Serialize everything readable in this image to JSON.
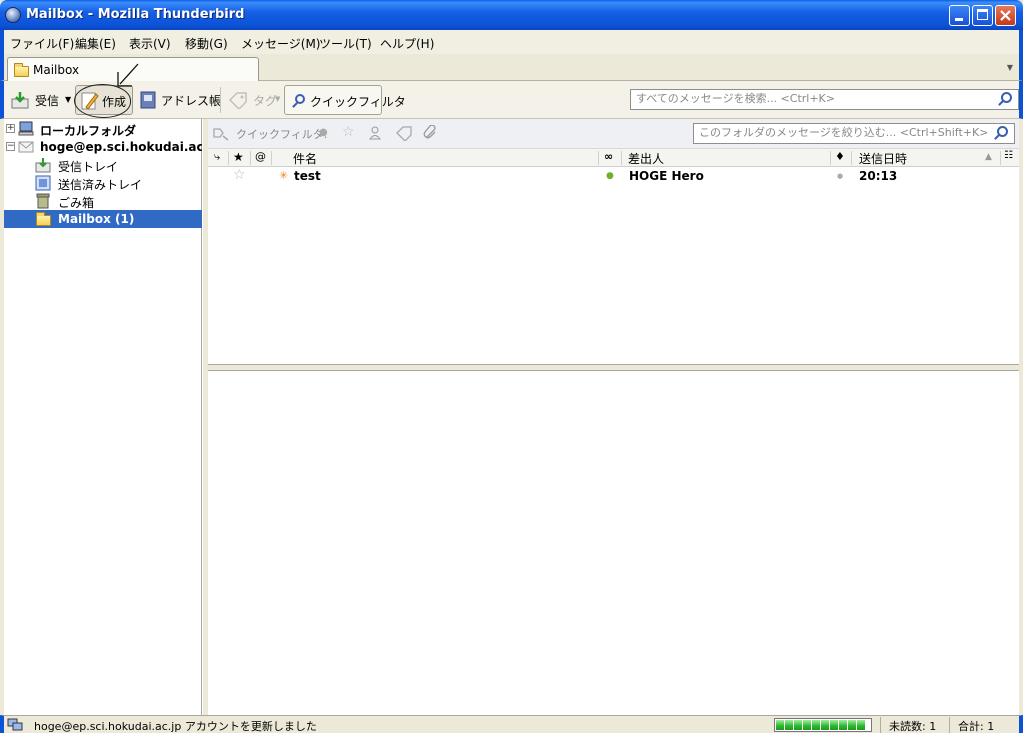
{
  "window": {
    "title": "Mailbox - Mozilla Thunderbird"
  },
  "menu": {
    "items": [
      "ファイル(F)",
      "編集(E)",
      "表示(V)",
      "移動(G)",
      "メッセージ(M)",
      "ツール(T)",
      "ヘルプ(H)"
    ]
  },
  "tab": {
    "label": "Mailbox"
  },
  "toolbar": {
    "get_mail": "受信",
    "compose": "作成",
    "address_book": "アドレス帳",
    "tag": "タグ",
    "quick_filter": "クイックフィルタ",
    "search_placeholder": "すべてのメッセージを検索... <Ctrl+K>"
  },
  "folders": {
    "local_folders": "ローカルフォルダ",
    "account": "hoge@ep.sci.hokudai.ac.jp",
    "inbox": "受信トレイ",
    "sent": "送信済みトレイ",
    "trash": "ごみ箱",
    "mailbox": "Mailbox (1)"
  },
  "quickfilter": {
    "label": "クイックフィルタ:",
    "placeholder": "このフォルダのメッセージを絞り込む... <Ctrl+Shift+K>"
  },
  "columns": {
    "subject": "件名",
    "from": "差出人",
    "date": "送信日時"
  },
  "messages": [
    {
      "subject": "test",
      "from": "HOGE Hero",
      "date": "20:13"
    }
  ],
  "status": {
    "text": "hoge@ep.sci.hokudai.ac.jp アカウントを更新しました",
    "unread": "未読数: 1",
    "total": "合計: 1",
    "progress": 1.0
  },
  "colors": {
    "titlebar": "#0b52d6",
    "selection": "#316ac5",
    "progress": "#2db52d"
  }
}
